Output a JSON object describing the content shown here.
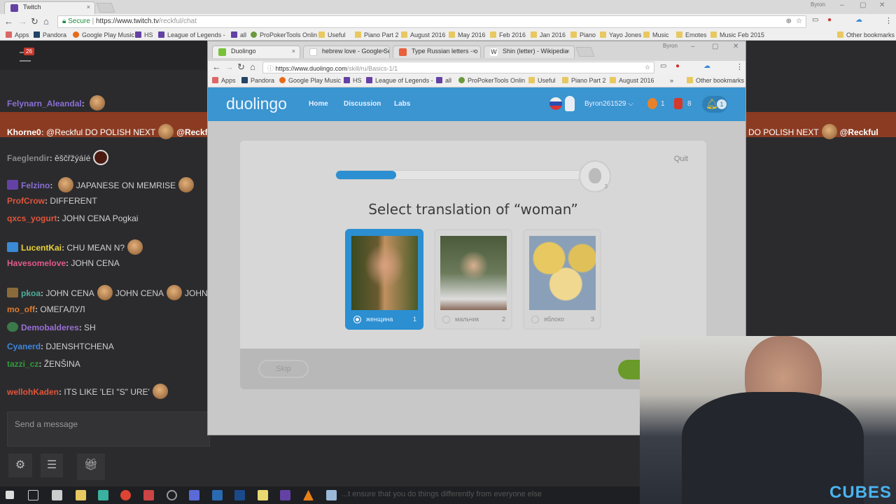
{
  "outer_browser": {
    "tab": "Twitch",
    "window_user": "Byron",
    "secure_label": "Secure",
    "url_host": "https://www.twitch.tv",
    "url_path": "/reckful/chat",
    "bookmarks": [
      "Apps",
      "Pandora",
      "Google Play Music",
      "HS",
      "League of Legends -",
      "all",
      "ProPokerTools Onlin",
      "Useful",
      "Piano Part 2",
      "August 2016",
      "May 2016",
      "Feb 2016",
      "Jan 2016",
      "Piano",
      "Yayo Jones",
      "Music",
      "Emotes",
      "Music Feb 2015"
    ],
    "other_bookmarks": "Other bookmarks"
  },
  "twitch": {
    "notification_count": "26",
    "chat": [
      {
        "user": "Felynarn_Aleandal",
        "color": "#8a6fd6",
        "msg": ""
      },
      {
        "user": "Khorne0",
        "color": "#ffffff",
        "msg": "@Reckful DO POLISH NEXT",
        "msg2": "@Reckful",
        "highlight": true
      },
      {
        "user": "Faeglendir",
        "color": "#888888",
        "msg": "ěščřžýáíé"
      },
      {
        "user": "Felzino",
        "color": "#8a6fd6",
        "msg": "JAPANESE ON MEMRISE"
      },
      {
        "user": "ProfCrow",
        "color": "#e0553c",
        "msg": "DIFFERENT"
      },
      {
        "user": "qxcs_yogurt",
        "color": "#e0553c",
        "msg": "JOHN CENA Pogkai"
      },
      {
        "user": "LucentKai",
        "color": "#e8d23a",
        "msg": "CHU MEAN N?"
      },
      {
        "user": "Havesomelove",
        "color": "#e05a8c",
        "msg": "JOHN CENA"
      },
      {
        "user": "pkoa",
        "color": "#4fae9a",
        "msg": "JOHN CENA",
        "msg2": "JOHN CENA",
        "msg3": "JOHN"
      },
      {
        "user": "mo_off",
        "color": "#e07a2c",
        "msg": "ОМЕГАЛУЛ"
      },
      {
        "user": "Demobalderes",
        "color": "#9a6fd6",
        "msg": "SH"
      },
      {
        "user": "Cyanerd",
        "color": "#3f86e0",
        "msg": "DJENSHTCHENA"
      },
      {
        "user": "tazzi_cz",
        "color": "#2f9a3a",
        "msg": "ŽENŠINA"
      },
      {
        "user": "wellohKaden",
        "color": "#e0553c",
        "msg": "ITS LIKE 'LEI \"S\" URE'"
      }
    ],
    "right_chat_fragment": "DO POLISH NEXT",
    "right_chat_mention": "@Reckful",
    "send_placeholder": "Send a message"
  },
  "inner_browser": {
    "tabs": [
      "Duolingo",
      "hebrew love - Google Se",
      "Type Russian letters - o",
      "Shin (letter) - Wikipedia"
    ],
    "window_user": "Byron",
    "url_host": "https://www.duolingo.com",
    "url_path": "/skill/ru/Basics-1/1",
    "bookmarks": [
      "Apps",
      "Pandora",
      "Google Play Music",
      "HS",
      "League of Legends -",
      "all",
      "ProPokerTools Onlin",
      "Useful",
      "Piano Part 2",
      "August 2016"
    ],
    "other_bookmarks": "Other bookmarks"
  },
  "duolingo": {
    "logo": "duolingo",
    "nav": [
      "Home",
      "Discussion",
      "Labs"
    ],
    "username": "Byron261529",
    "streak": "1",
    "lingots": "8",
    "notifications": "1",
    "brand_color": "#1cb0f6",
    "quit": "Quit",
    "progress_percent": 10,
    "progress_badge": "3",
    "prompt": "Select translation of “woman”",
    "options": [
      {
        "label": "женщина",
        "num": "1",
        "selected": true
      },
      {
        "label": "мальчик",
        "num": "2",
        "selected": false
      },
      {
        "label": "яблоко",
        "num": "3",
        "selected": false
      }
    ],
    "skip": "Skip"
  },
  "taskbar_ticker": "...t ensure that you do things differently from everyone else",
  "cam_logo": "CUBES"
}
